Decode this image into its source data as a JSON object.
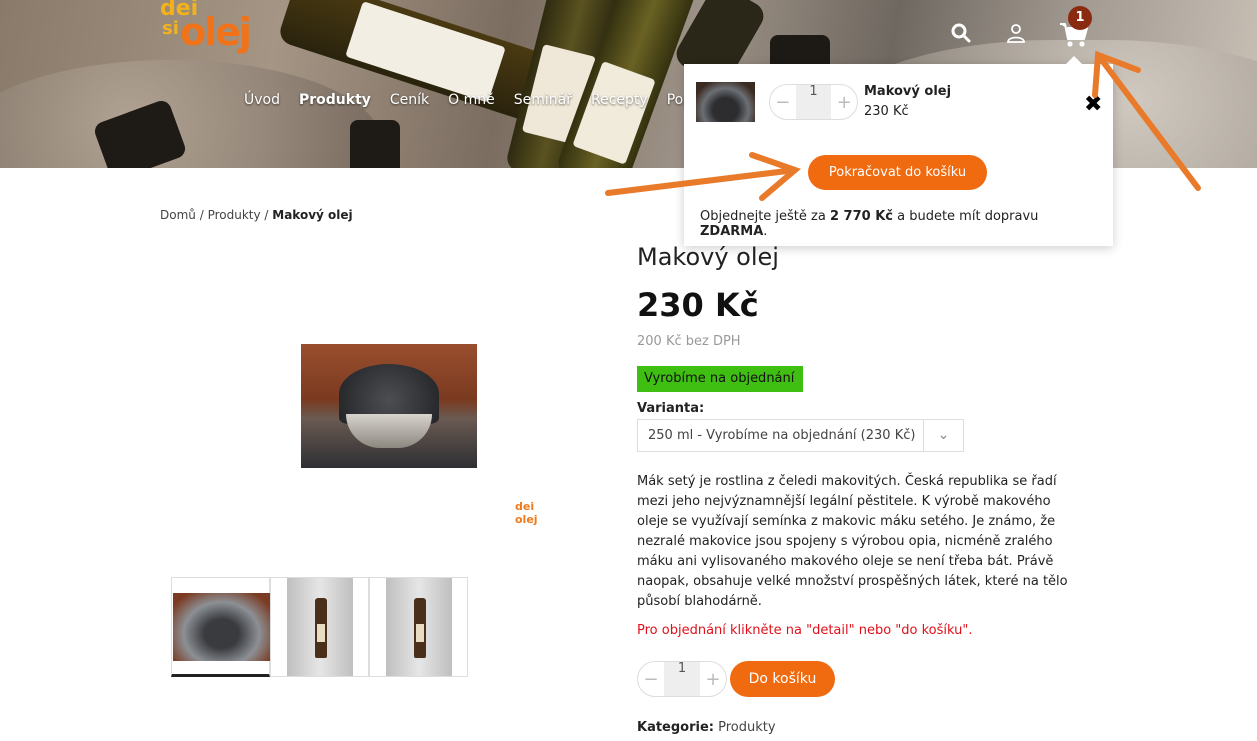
{
  "header": {
    "logo": {
      "line1": "dei",
      "line2": "si",
      "line3": "olej"
    },
    "nav": [
      "Úvod",
      "Produkty",
      "Ceník",
      "O mně",
      "Seminář",
      "Recepty",
      "Popis"
    ],
    "nav_active_index": 1,
    "cart_count": "1"
  },
  "minicart": {
    "item_name": "Makový olej",
    "item_price": "230 Kč",
    "qty_minus": "−",
    "qty": "1",
    "qty_plus": "+",
    "close": "✖",
    "continue_label": "Pokračovat do košíku",
    "note_prefix": "Objednejte ještě za ",
    "note_amount": "2 770 Kč",
    "note_middle": " a budete mít dopravu ",
    "note_free": "ZDARMA",
    "note_suffix": "."
  },
  "breadcrumb": {
    "home": "Domů",
    "sep": " / ",
    "category": "Produkty",
    "current": "Makový olej"
  },
  "gallery": {
    "watermark": "dei olej",
    "thumbs": 3
  },
  "product": {
    "title": "Makový olej",
    "price": "230 Kč",
    "price_net": "200 Kč bez DPH",
    "stock": "Vyrobíme na objednání",
    "variant_label": "Varianta:",
    "variant_value": "250 ml - Vyrobíme na objednání  (230 Kč)",
    "description": "Mák setý je rostlina z čeledi makovitých. Česká republika se řadí mezi jeho nejvýznamnější legální pěstitele. K výrobě makového oleje se využívají semínka z makovic máku setého. Je známo, že nezralé makovice jsou spojeny s výrobou opia, nicméně zralého máku ani vylisovaného makového oleje se není třeba bát. Právě naopak, obsahuje velké množství prospěšných látek, které na tělo působí blahodárně.",
    "order_note": "Pro objednání klikněte na \"detail\" nebo \"do košíku\".",
    "qty_minus": "−",
    "qty": "1",
    "qty_plus": "+",
    "add_to_cart": "Do košíku",
    "category_label": "Kategorie:",
    "category_value": " Produkty"
  },
  "colors": {
    "accent": "#f06a10",
    "stock": "#3fbf11",
    "alert": "#e0101a",
    "annotation": "#e87a2a"
  }
}
